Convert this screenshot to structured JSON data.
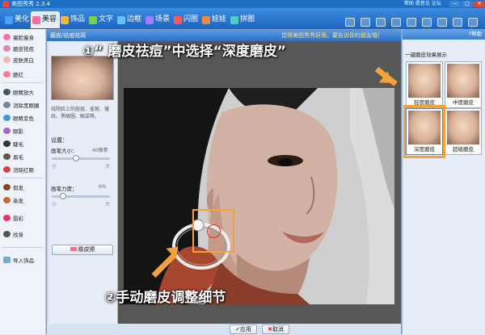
{
  "window": {
    "title": "美图秀秀 2.3.4",
    "links": "帮助  提意见  论坛",
    "min": "—",
    "max": "□",
    "close": "✕"
  },
  "tabs": [
    {
      "label": "美化",
      "color": "#4aa2ff"
    },
    {
      "label": "美容",
      "color": "#ff6aa2"
    },
    {
      "label": "饰品",
      "color": "#ffb23a"
    },
    {
      "label": "文字",
      "color": "#7ad04a"
    },
    {
      "label": "边框",
      "color": "#66c3ff"
    },
    {
      "label": "场景",
      "color": "#a57bff"
    },
    {
      "label": "闪图",
      "color": "#ff5a5a"
    },
    {
      "label": "娃娃",
      "color": "#f08a3a"
    },
    {
      "label": "拼图",
      "color": "#4ad0c2"
    }
  ],
  "tools": [
    "打开",
    "保存",
    "抠图",
    "裁剪",
    "尺寸",
    "旋转",
    "涂鸦",
    "撤销",
    "看图"
  ],
  "sidebar": {
    "items": [
      {
        "label": "瘦脸瘦身",
        "c": "#e7a"
      },
      {
        "label": "磨皮祛痘",
        "c": "#d8a"
      },
      {
        "label": "皮肤美白",
        "c": "#eba"
      },
      {
        "label": "腮红",
        "c": "#f79"
      },
      {
        "label": "眼睛放大",
        "c": "#456"
      },
      {
        "label": "消除黑眼圈",
        "c": "#789"
      },
      {
        "label": "眼睛变色",
        "c": "#49c"
      },
      {
        "label": "眼影",
        "c": "#a6c"
      },
      {
        "label": "睫毛",
        "c": "#333"
      },
      {
        "label": "眉毛",
        "c": "#654"
      },
      {
        "label": "消除红眼",
        "c": "#c44"
      },
      {
        "label": "假发",
        "c": "#843"
      },
      {
        "label": "染发",
        "c": "#c63"
      },
      {
        "label": "唇彩",
        "c": "#e36"
      },
      {
        "label": "纹身",
        "c": "#555"
      },
      {
        "label": "导入饰品",
        "c": "#7ac"
      }
    ]
  },
  "panel": {
    "title": "磨皮/祛痘祛斑",
    "notice": "觉得美图秀秀好用，要告诉你的朋友哦！",
    "subtitle": "磨皮祛痘祛斑",
    "desc": "祛除脸上的痘痘、雀斑、皱纹、黑眼圈、眼袋等。",
    "settings_label": "设置：",
    "brush_size_label": "画笔大小：",
    "brush_size_value": "40像素",
    "brush_size_level": 0.4,
    "brush_power_label": "画笔力度：",
    "brush_power_value": "6%",
    "brush_power_level": 0.15,
    "small": "小",
    "large": "大",
    "eraser_label": "橡皮擦",
    "apply_label": "应用",
    "cancel_label": "取消"
  },
  "rightpanel": {
    "title": "一键磨皮效果展示",
    "help": "帮助",
    "thumbs": [
      "轻度磨皮",
      "中度磨皮",
      "深度磨皮",
      "超级磨皮"
    ],
    "selected_index": 2
  },
  "annotations": {
    "top": "①“ 磨皮祛痘”中选择“深度磨皮”",
    "bottom": "②手动磨皮调整细节"
  },
  "colors": {
    "orange": "#f5a23a",
    "title_blue": "#1f6fc9"
  }
}
